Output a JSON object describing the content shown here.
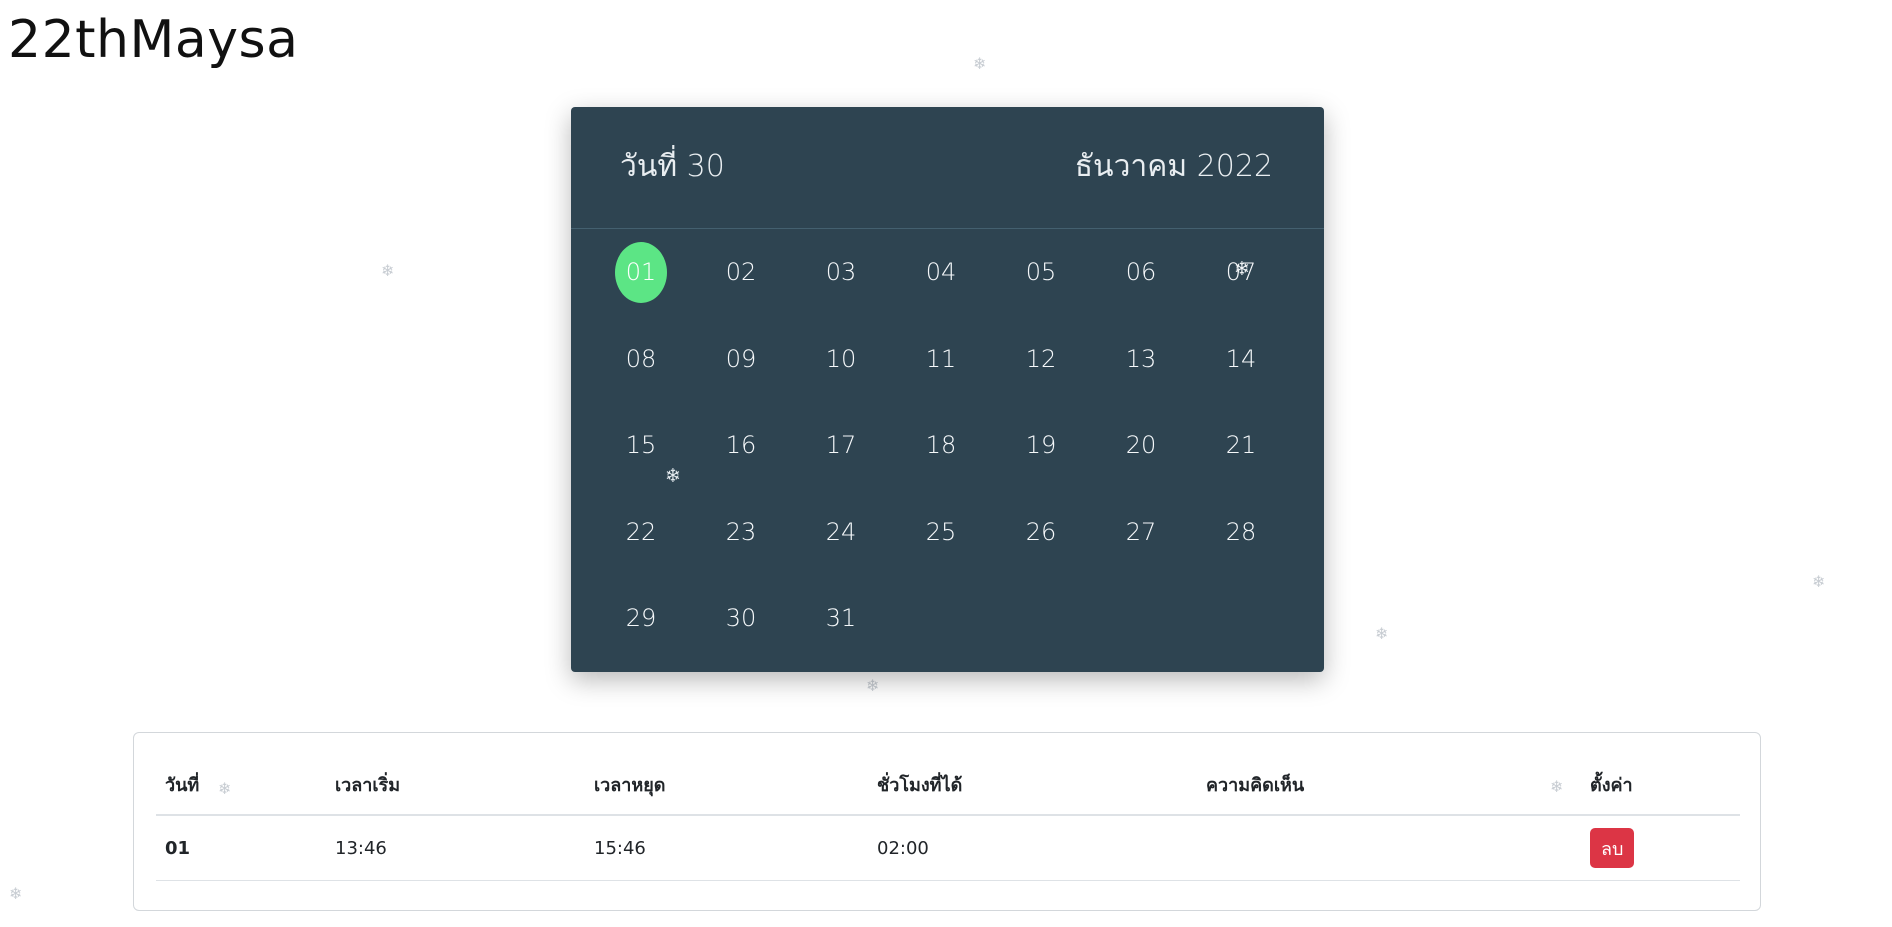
{
  "site": {
    "title": "22thMaysa"
  },
  "decor": {
    "snowflake_glyph": "❄"
  },
  "calendar": {
    "day_label": "วันที่ 30",
    "month_label": "ธันวาคม 2022",
    "selected_day": "01",
    "days": [
      "01",
      "02",
      "03",
      "04",
      "05",
      "06",
      "07",
      "08",
      "09",
      "10",
      "11",
      "12",
      "13",
      "14",
      "15",
      "16",
      "17",
      "18",
      "19",
      "20",
      "21",
      "22",
      "23",
      "24",
      "25",
      "26",
      "27",
      "28",
      "29",
      "30",
      "31"
    ],
    "colors": {
      "background": "#2e4451",
      "selected": "#5ce585"
    }
  },
  "table": {
    "headers": [
      "วันที่",
      "เวลาเริ่ม",
      "เวลาหยุด",
      "ชั่วโมงที่ได้",
      "ความคิดเห็น",
      "ตั้งค่า"
    ],
    "rows": [
      {
        "day": "01",
        "start": "13:46",
        "stop": "15:46",
        "hours": "02:00",
        "comment": "",
        "action_label": "ลบ"
      }
    ],
    "colors": {
      "delete_button": "#dc3545"
    }
  }
}
